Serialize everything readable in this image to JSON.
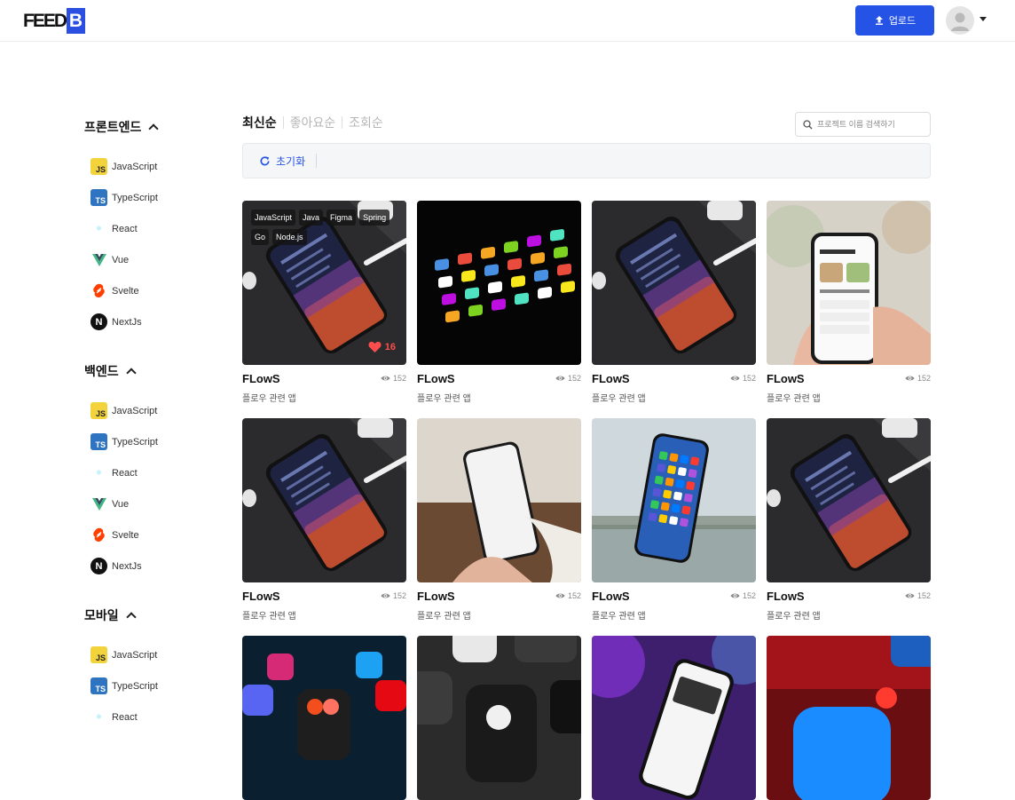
{
  "header": {
    "logo_text": "FEED",
    "logo_letter": "B",
    "upload_label": "업로드"
  },
  "sidebar": {
    "sections": [
      {
        "title": "프론트엔드",
        "items": [
          "JavaScript",
          "TypeScript",
          "React",
          "Vue",
          "Svelte",
          "NextJs"
        ]
      },
      {
        "title": "백엔드",
        "items": [
          "JavaScript",
          "TypeScript",
          "React",
          "Vue",
          "Svelte",
          "NextJs"
        ]
      },
      {
        "title": "모바일",
        "items": [
          "JavaScript",
          "TypeScript",
          "React"
        ]
      }
    ],
    "icon_marks": {
      "js": "JS",
      "ts": "TS",
      "react": "⚛",
      "next": "N"
    }
  },
  "sort_tabs": [
    "최신순",
    "좋아요순",
    "조회순"
  ],
  "search": {
    "placeholder": "프로젝트 이름 검색하기"
  },
  "filter": {
    "reset_label": "초기화"
  },
  "cards": [
    {
      "title": "FLowS",
      "desc": "플로우 관련 앱",
      "views": "152",
      "tags": [
        "JavaScript",
        "Java",
        "Figma",
        "Spring",
        "Go",
        "Node.js"
      ],
      "likes": "16",
      "image": "phone-on-desk-dark"
    },
    {
      "title": "FLowS",
      "desc": "플로우 관련 앱",
      "views": "152",
      "image": "phone-dark-apps"
    },
    {
      "title": "FLowS",
      "desc": "플로우 관련 앱",
      "views": "152",
      "image": "phone-on-desk-dark"
    },
    {
      "title": "FLowS",
      "desc": "플로우 관련 앱",
      "views": "152",
      "image": "hand-holding-phone-app"
    },
    {
      "title": "FLowS",
      "desc": "플로우 관련 앱",
      "views": "152",
      "image": "phone-on-desk-dark"
    },
    {
      "title": "FLowS",
      "desc": "플로우 관련 앱",
      "views": "152",
      "image": "hand-holding-blank-phone"
    },
    {
      "title": "FLowS",
      "desc": "플로우 관련 앱",
      "views": "152",
      "image": "floating-iphone"
    },
    {
      "title": "FLowS",
      "desc": "플로우 관련 앱",
      "views": "152",
      "image": "phone-on-desk-dark"
    },
    {
      "title": "",
      "desc": "",
      "views": "",
      "image": "social-app-icons"
    },
    {
      "title": "",
      "desc": "",
      "views": "",
      "image": "app-icons-closeup"
    },
    {
      "title": "",
      "desc": "",
      "views": "",
      "image": "phone-purple-light"
    },
    {
      "title": "",
      "desc": "",
      "views": "",
      "image": "app-store-imgur"
    }
  ],
  "colors": {
    "accent": "#2553e6",
    "like": "#ff4d4d"
  }
}
